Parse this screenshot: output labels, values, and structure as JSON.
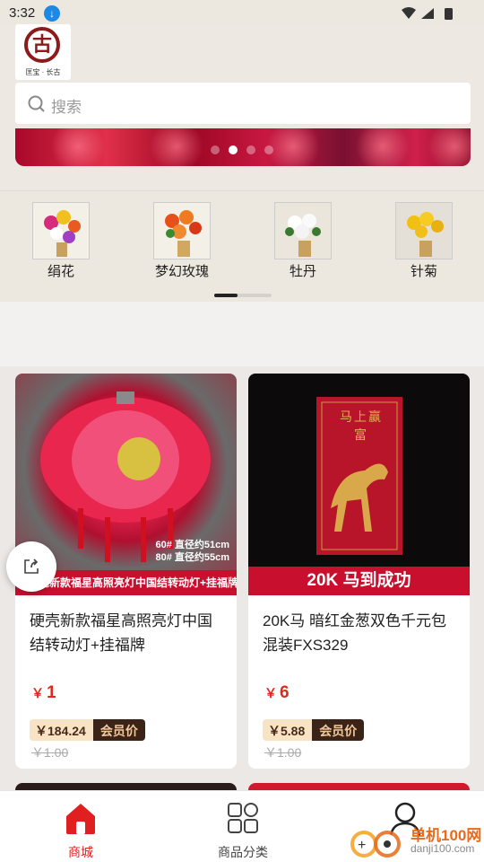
{
  "status_bar": {
    "time": "3:32"
  },
  "header": {
    "logo_text": "古",
    "logo_subtitle": "匡宝 · 长古"
  },
  "search": {
    "placeholder": "搜索"
  },
  "banner": {
    "page_count": 4,
    "active_page": 2
  },
  "categories": [
    {
      "label": "绢花"
    },
    {
      "label": "梦幻玫瑰"
    },
    {
      "label": "牡丹"
    },
    {
      "label": "针菊"
    }
  ],
  "products": [
    {
      "image_caption": "硬壳新款福星高照亮灯中国结转动灯+挂福牌",
      "image_spec1": "60# 直径约51cm",
      "image_spec2": "80# 直径约55cm",
      "name": "硬壳新款福星高照亮灯中国结转动灯+挂福牌",
      "currency": "￥",
      "price": "1",
      "member_price": "￥184.24",
      "member_tag": "会员价",
      "original_price": "￥1.00"
    },
    {
      "image_caption": "20K 马到成功",
      "image_text": "马上赢富",
      "name": "20K马 暗红金葱双色千元包混装FXS329",
      "currency": "￥",
      "price": "6",
      "member_price": "￥5.88",
      "member_tag": "会员价",
      "original_price": "￥1.00"
    }
  ],
  "tabbar": [
    {
      "label": "商城",
      "icon": "home-icon",
      "active": true
    },
    {
      "label": "商品分类",
      "icon": "category-grid-icon",
      "active": false
    },
    {
      "label": "",
      "icon": "user-icon",
      "active": false
    }
  ],
  "watermark": {
    "text": "单机100网",
    "url": "danji100.com"
  },
  "colors": {
    "accent": "#e02020",
    "member_bg": "#f8e3c4",
    "member_tag_bg": "#3b2318"
  }
}
